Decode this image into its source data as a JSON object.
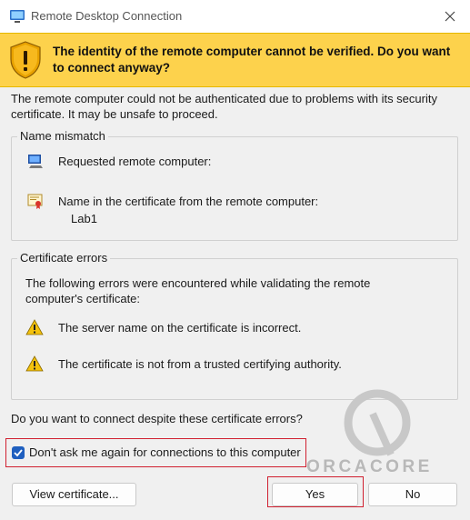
{
  "window": {
    "title": "Remote Desktop Connection"
  },
  "banner": {
    "text": "The identity of the remote computer cannot be verified. Do you want to connect anyway?"
  },
  "intro": "The remote computer could not be authenticated due to problems with its security certificate. It may be unsafe to proceed.",
  "name_mismatch": {
    "legend": "Name mismatch",
    "requested_label": "Requested remote computer:",
    "cert_label": "Name in the certificate from the remote computer:",
    "cert_value": "Lab1"
  },
  "cert_errors": {
    "legend": "Certificate errors",
    "intro": "The following errors were encountered while validating the remote computer's certificate:",
    "errors": [
      "The server name on the certificate is incorrect.",
      "The certificate is not from a trusted certifying authority."
    ]
  },
  "question": "Do you want to connect despite these certificate errors?",
  "dont_ask": {
    "label": "Don't ask me again for connections to this computer",
    "checked": true
  },
  "buttons": {
    "view_certificate": "View certificate...",
    "yes": "Yes",
    "no": "No"
  },
  "watermark": "ORCACORE",
  "colors": {
    "banner": "#fdd24c",
    "highlight": "#d02030",
    "checkbox": "#1f5fbf"
  }
}
